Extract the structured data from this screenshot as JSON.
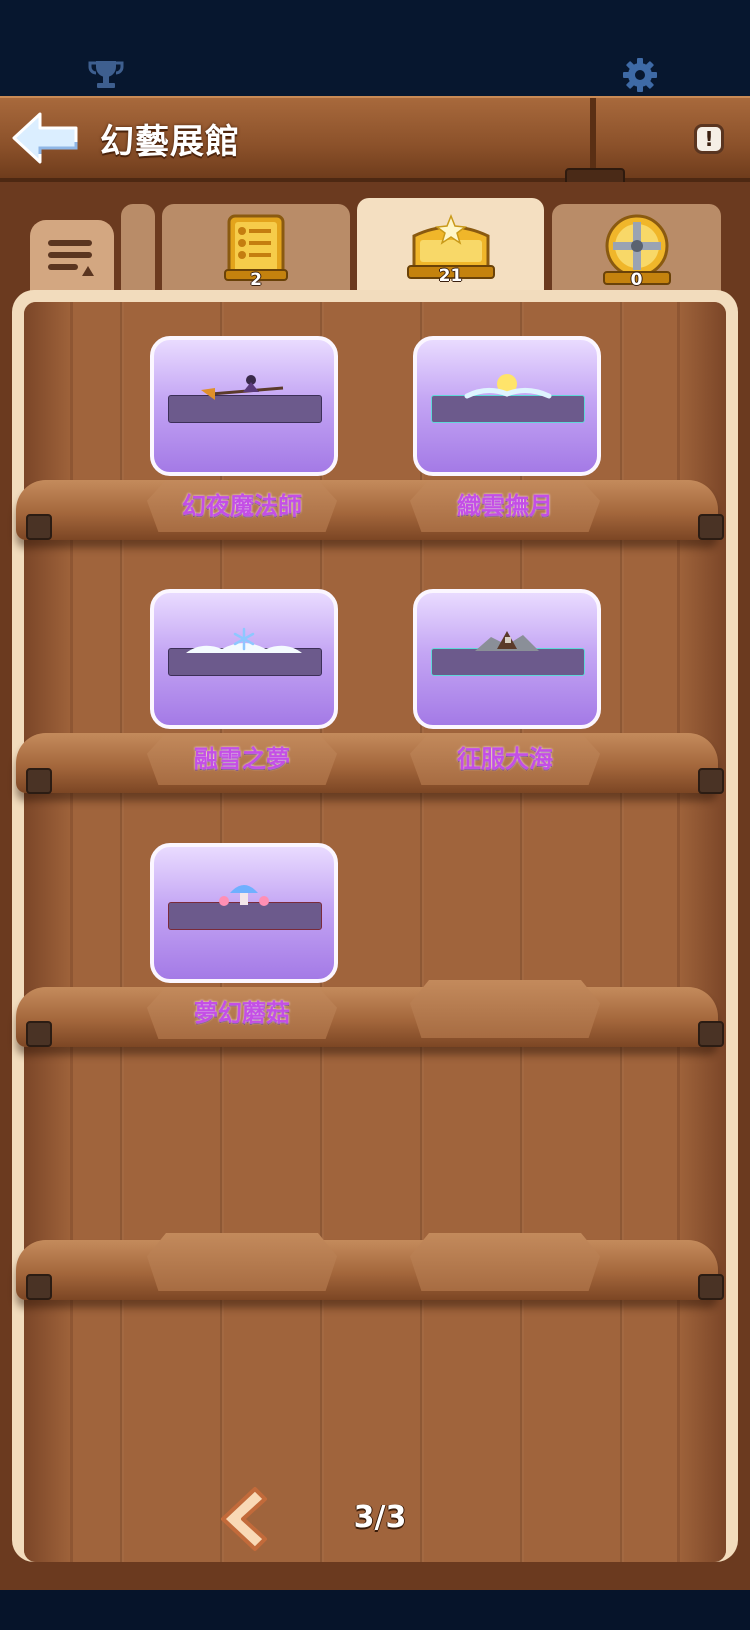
{
  "header": {
    "title": "幻藝展館",
    "info_label": "!"
  },
  "tabs": [
    {
      "name": "list",
      "count": "2",
      "active": false
    },
    {
      "name": "chest",
      "count": "21",
      "active": true
    },
    {
      "name": "medal",
      "count": "0",
      "active": false
    }
  ],
  "exhibits": [
    {
      "label": "幻夜魔法師",
      "icon": "witch-broom-icon"
    },
    {
      "label": "織雲撫月",
      "icon": "moon-cloud-icon"
    },
    {
      "label": "融雪之夢",
      "icon": "snowflake-cloud-icon"
    },
    {
      "label": "征服大海",
      "icon": "ship-waves-icon"
    },
    {
      "label": "夢幻蘑菇",
      "icon": "mushroom-icon"
    }
  ],
  "pagination": {
    "indicator": "3/3"
  },
  "colors": {
    "wood": "#a0643c",
    "card_purple": "#c4a6f4",
    "label_magenta": "#c44fe6",
    "nav_dark": "#07172f"
  }
}
